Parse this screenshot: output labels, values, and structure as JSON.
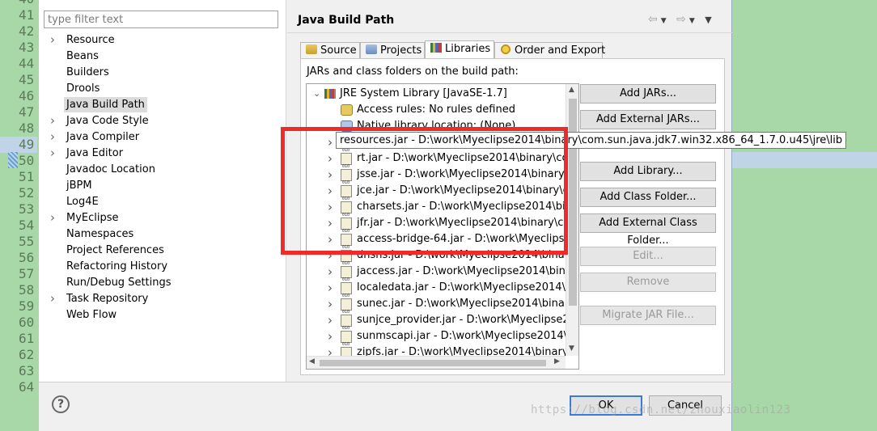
{
  "gutter": {
    "line_numbers": [
      "40",
      "41",
      "42",
      "43",
      "44",
      "45",
      "46",
      "47",
      "48",
      "49",
      "50",
      "51",
      "52",
      "53",
      "54",
      "55",
      "56",
      "57",
      "58",
      "59",
      "60",
      "61",
      "62",
      "63",
      "64"
    ]
  },
  "filter": {
    "placeholder": "type filter text"
  },
  "properties": [
    {
      "label": "Resource",
      "expandable": true
    },
    {
      "label": "Beans",
      "expandable": false
    },
    {
      "label": "Builders",
      "expandable": false
    },
    {
      "label": "Drools",
      "expandable": false
    },
    {
      "label": "Java Build Path",
      "expandable": false,
      "selected": true
    },
    {
      "label": "Java Code Style",
      "expandable": true
    },
    {
      "label": "Java Compiler",
      "expandable": true
    },
    {
      "label": "Java Editor",
      "expandable": true
    },
    {
      "label": "Javadoc Location",
      "expandable": false
    },
    {
      "label": "jBPM",
      "expandable": false
    },
    {
      "label": "Log4E",
      "expandable": false
    },
    {
      "label": "MyEclipse",
      "expandable": true
    },
    {
      "label": "Namespaces",
      "expandable": false
    },
    {
      "label": "Project References",
      "expandable": false
    },
    {
      "label": "Refactoring History",
      "expandable": false
    },
    {
      "label": "Run/Debug Settings",
      "expandable": false
    },
    {
      "label": "Task Repository",
      "expandable": true
    },
    {
      "label": "Web Flow",
      "expandable": false
    }
  ],
  "page": {
    "title": "Java Build Path"
  },
  "tabs": [
    {
      "label": "Source"
    },
    {
      "label": "Projects"
    },
    {
      "label": "Libraries",
      "active": true
    },
    {
      "label": "Order and Export"
    }
  ],
  "libraries": {
    "label": "JARs and class folders on the build path:",
    "root": "JRE System Library [JavaSE-1.7]",
    "access_rules": "Access rules: No rules defined",
    "native_location": "Native library location: (None)",
    "jars": [
      "resources.jar - D:\\work\\Myeclipse2014\\binary\\com.sun.java.jdk7.win32.x86_64_1.7.0.u45\\jre\\lib",
      "rt.jar - D:\\work\\Myeclipse2014\\binary\\com.sun.java.jdk7",
      "jsse.jar - D:\\work\\Myeclipse2014\\binary\\com.sun.java",
      "jce.jar - D:\\work\\Myeclipse2014\\binary\\com.sun.java",
      "charsets.jar - D:\\work\\Myeclipse2014\\binary\\com.sun",
      "jfr.jar - D:\\work\\Myeclipse2014\\binary\\com.sun.java",
      "access-bridge-64.jar - D:\\work\\Myeclipse2014\\binary",
      "dnsns.jar - D:\\work\\Myeclipse2014\\binary\\com.sun",
      "jaccess.jar - D:\\work\\Myeclipse2014\\binary\\com.sun",
      "localedata.jar - D:\\work\\Myeclipse2014\\binary\\com",
      "sunec.jar - D:\\work\\Myeclipse2014\\binary\\com.sun",
      "sunjce_provider.jar - D:\\work\\Myeclipse2014\\binary",
      "sunmscapi.jar - D:\\work\\Myeclipse2014\\binary\\com",
      "zipfs.jar - D:\\work\\Myeclipse2014\\binary\\com.sun"
    ],
    "tooltip": "resources.jar - D:\\work\\Myeclipse2014\\binary\\com.sun.java.jdk7.win32.x86_64_1.7.0.u45\\jre\\lib"
  },
  "buttons": {
    "add_jars": "Add JARs...",
    "add_external_jars": "Add External JARs...",
    "add_library": "Add Library...",
    "add_class_folder": "Add Class Folder...",
    "add_external_class_folder": "Add External Class Folder...",
    "edit": "Edit...",
    "remove": "Remove",
    "migrate_jar": "Migrate JAR File..."
  },
  "dialog": {
    "help": "?",
    "ok": "OK",
    "cancel": "Cancel"
  },
  "watermark": "https://blog.csdn.net/zhouxiaolin123",
  "colors": {
    "highlight_box": "#ee2a2a",
    "editor_bg": "#a8d8a8",
    "default_button_border": "#3a7bd5"
  }
}
